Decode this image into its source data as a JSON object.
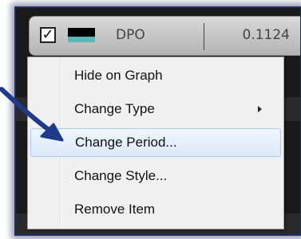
{
  "legend": {
    "checked_mark": "✓",
    "series_name": "DPO",
    "series_value": "0.1124",
    "swatch_colors": {
      "line": "#000000",
      "fill": "#58b7b9"
    }
  },
  "context_menu": {
    "items": [
      {
        "label": "Hide on Graph",
        "has_submenu": false,
        "highlighted": false
      },
      {
        "label": "Change Type",
        "has_submenu": true,
        "highlighted": false
      },
      {
        "label": "Change Period...",
        "has_submenu": false,
        "highlighted": true
      },
      {
        "label": "Change Style...",
        "has_submenu": false,
        "highlighted": false
      },
      {
        "label": "Remove Item",
        "has_submenu": false,
        "highlighted": false
      }
    ]
  },
  "colors": {
    "annotation_arrow": "#1f3a8a",
    "panel_frame": "#1e2f70",
    "highlight_border": "#a9cbef"
  },
  "icons": {
    "checkbox": "checkbox-checked-icon",
    "submenu": "chevron-right-icon",
    "annotation": "arrow-icon"
  }
}
